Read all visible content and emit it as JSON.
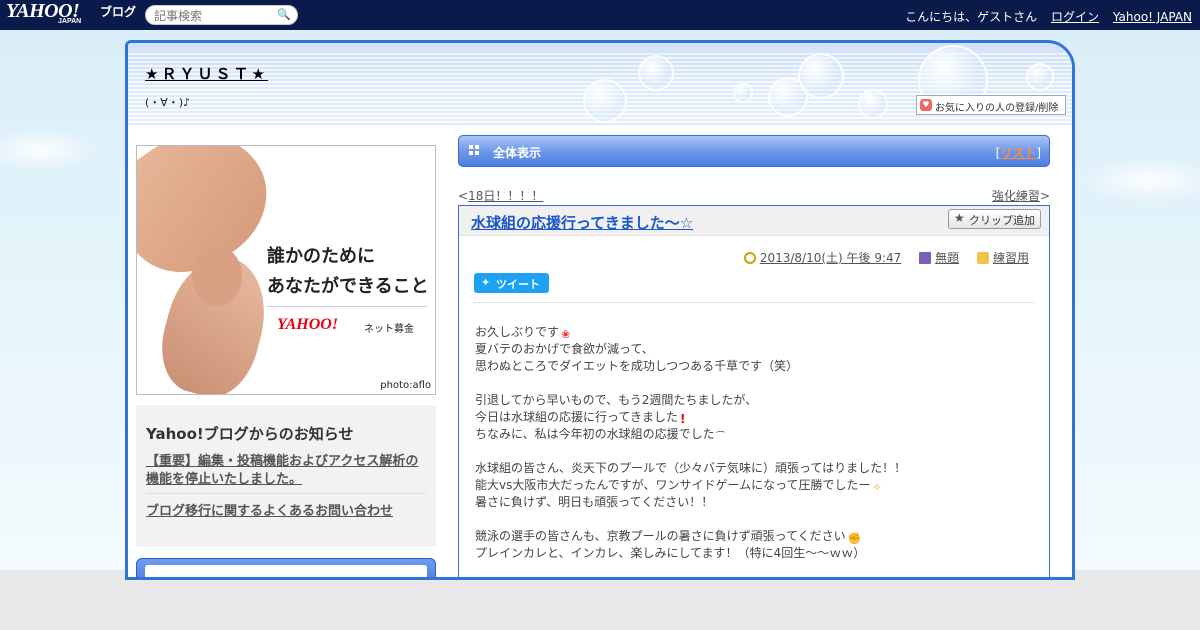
{
  "topbar": {
    "logo": "YAHOO!",
    "logo_sub": "JAPAN",
    "logo_blog": "ブログ",
    "search_placeholder": "記事検索",
    "greeting": "こんにちは、ゲストさん",
    "login": "ログイン",
    "yahoo_japan": "Yahoo! JAPAN"
  },
  "header": {
    "blog_title": "★ＲＹＵＳＴ★",
    "subtitle": "(・∀・)♪",
    "fav_button": "お気に入りの人の登録/削除"
  },
  "ad": {
    "line1": "誰かのために",
    "line2": "あなたができること",
    "logo": "YAHOO!",
    "logo_sub": "ネット募金",
    "credit": "photo:aflo"
  },
  "notice": {
    "title": "Yahoo!ブログからのお知らせ",
    "item1": "【重要】編集・投稿機能およびアクセス解析の機能を停止いたしました。",
    "item2": "ブログ移行に関するよくあるお問い合わせ"
  },
  "bar": {
    "title": "全体表示",
    "list_open": "[",
    "list_label": "リスト",
    "list_close": "]"
  },
  "pager": {
    "prev_prefix": "<",
    "prev": "18日！！！！",
    "next": "強化練習",
    "next_suffix": ">"
  },
  "post": {
    "title": "水球組の応援行ってきました～☆",
    "clip": "クリップ追加",
    "date": "2013/8/10(土) 午後 9:47",
    "tag": "無題",
    "category": "練習用",
    "tweet": "ツイート",
    "lines": [
      "お久しぶりです",
      "夏バテのおかげで食欲が減って、",
      "思わぬところでダイエットを成功しつつある千草です（笑）",
      "",
      "引退してから早いもので、もう2週間たちましたが、",
      "今日は水球組の応援に行ってきました",
      "ちなみに、私は今年初の水球組の応援でした",
      "",
      "水球組の皆さん、炎天下のプールで（少々バテ気味に）頑張ってはりました！！",
      "能大vs大阪市大だったんですが、ワンサイドゲームになって圧勝でしたー",
      "暑さに負けず、明日も頑張ってください！！",
      "",
      "競泳の選手の皆さんも、京教プールの暑さに負けず頑張ってください",
      "プレインカレと、インカレ、楽しみにしてます！（特に4回生～～ｗｗ）"
    ]
  },
  "colors": {
    "topbar": "#0a1a4a",
    "frame_border": "#3373d6",
    "link_blue": "#1a55c9",
    "list_orange": "#ff8c3a",
    "tweet_blue": "#1da1f2"
  }
}
